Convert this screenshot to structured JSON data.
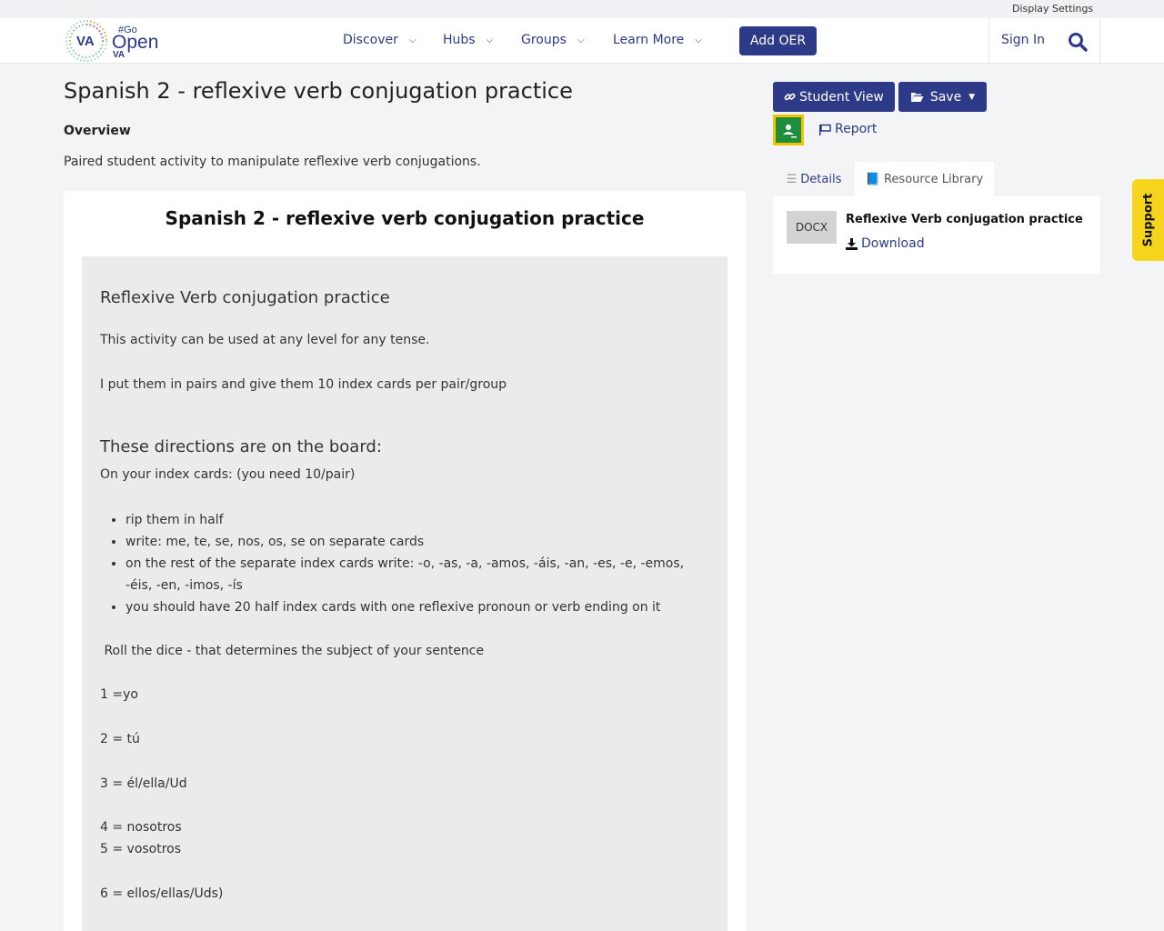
{
  "topbar": {
    "display_settings": "Display Settings"
  },
  "logo": {
    "va": "VA",
    "go": "#Go",
    "open": "Open",
    "va_small": "VA"
  },
  "nav": {
    "items": [
      {
        "label": "Discover"
      },
      {
        "label": "Hubs"
      },
      {
        "label": "Groups"
      },
      {
        "label": "Learn More"
      }
    ],
    "add_oer": "Add OER",
    "sign_in": "Sign In"
  },
  "page": {
    "title": "Spanish 2 - reflexive verb conjugation practice",
    "overview_label": "Overview",
    "overview_text": "Paired student activity to manipulate reflexive verb conjugations."
  },
  "document": {
    "title": "Spanish 2 - reflexive verb conjugation practice",
    "heading1": "Reflexive Verb conjugation practice",
    "p1": "This activity can be used at any level for any tense.",
    "p2": "I put them in pairs and give them 10 index cards per pair/group",
    "heading2": "These directions are on the board:",
    "p3": "On your index cards: (you need 10/pair)",
    "list": [
      "rip them in half",
      "write: me, te, se, nos, os, se on separate cards",
      "on the rest of the separate index cards write: -o, -as, -a, -amos, -áis, -an, -es, -e, -emos, -éis, -en, -imos, -ís",
      "you should have 20 half index cards with one reflexive pronoun or verb ending on it"
    ],
    "p4": " Roll the dice - that determines the subject of your sentence",
    "dice": [
      "1 =yo",
      "2 = tú",
      "3 = él/ella/Ud",
      "4 = nosotros",
      "5 = vosotros",
      "6 = ellos/ellas/Uds)"
    ]
  },
  "sidebar": {
    "student_view": "Student View",
    "save": "Save",
    "report": "Report",
    "tabs": {
      "details": "Details",
      "library": "Resource Library"
    },
    "resource": {
      "type": "DOCX",
      "title": "Reflexive Verb conjugation practice",
      "download": "Download"
    }
  },
  "support": "Support",
  "colors": {
    "primary": "#2d3a87",
    "accent_yellow": "#f7d51d",
    "classroom_green": "#1e8e3e"
  }
}
